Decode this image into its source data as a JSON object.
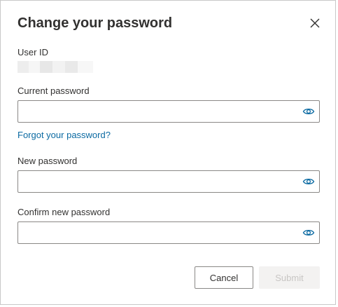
{
  "dialog": {
    "title": "Change your password",
    "close_icon": "close-icon"
  },
  "user_id": {
    "label": "User ID"
  },
  "current_password": {
    "label": "Current password",
    "value": "",
    "show_icon": "eye-icon"
  },
  "forgot_link": "Forgot your password?",
  "new_password": {
    "label": "New password",
    "value": "",
    "show_icon": "eye-icon"
  },
  "confirm_password": {
    "label": "Confirm new password",
    "value": "",
    "show_icon": "eye-icon"
  },
  "buttons": {
    "cancel": "Cancel",
    "submit": "Submit",
    "submit_disabled": true
  },
  "colors": {
    "accent": "#0b6aa2",
    "border": "#8a8886",
    "text": "#323130",
    "disabled_bg": "#f3f2f1",
    "disabled_text": "#c8c6c4"
  }
}
